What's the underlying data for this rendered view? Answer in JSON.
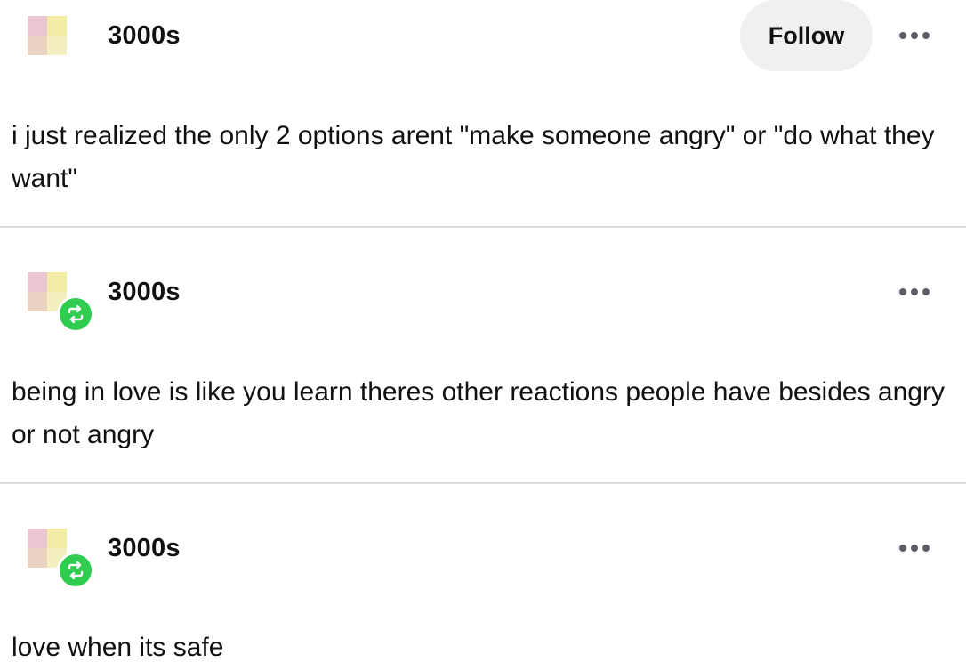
{
  "colors": {
    "follow_bg": "#f0f0f2",
    "reblog_green": "#2fcc4f",
    "avatar_pink": "#ecc6d2",
    "avatar_yellow": "#f0eca6",
    "avatar_peach": "#ebd3c4",
    "avatar_pale_yellow": "#f3efbf",
    "divider": "#dcdcdc"
  },
  "posts": [
    {
      "username": "3000s",
      "follow_label": "Follow",
      "avatar_icon": "avatar",
      "more_icon": "more-dots-icon",
      "body": "i just realized the only 2 options arent \"make someone angry\" or \"do what they want\""
    },
    {
      "username": "3000s",
      "reblog_icon": "reblog-icon",
      "more_icon": "more-dots-icon",
      "body": "being in love is like you learn theres other reactions people have besides angry or not angry"
    },
    {
      "username": "3000s",
      "reblog_icon": "reblog-icon",
      "more_icon": "more-dots-icon",
      "body": "love when its safe"
    }
  ]
}
